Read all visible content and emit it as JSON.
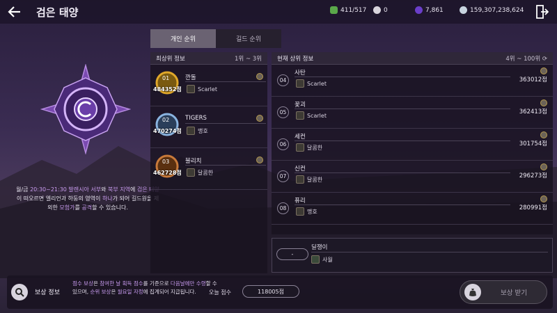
{
  "header": {
    "title": "검은 태양"
  },
  "resources": [
    {
      "icon": "energy-icon",
      "value": "411/517",
      "color": "#5aa84a"
    },
    {
      "icon": "pearl-icon",
      "value": "0",
      "color": "#d8d4dc"
    },
    {
      "icon": "crystal-icon",
      "value": "7,861",
      "color": "#6a3ec9"
    },
    {
      "icon": "silver-icon",
      "value": "159,307,238,624",
      "color": "#c8d4e0"
    }
  ],
  "description": {
    "p1": "월/금 ",
    "p2": "20:30~21:30 ",
    "p3": "발렌시아 서부",
    "p4": "와 ",
    "p5": "북부 지역",
    "p6": "에 ",
    "p7": "검은 태양",
    "p8": "이 떠오르면 엘리언과 하둠의 영역이 ",
    "p9": "하나",
    "p10": "가 되어 길드원을 제외한 ",
    "p11": "모험가",
    "p12": "를 ",
    "p13": "공격",
    "p14": "할 수 있습니다."
  },
  "tabs": [
    {
      "label": "개인 순위"
    },
    {
      "label": "길드 순위"
    }
  ],
  "top_panel": {
    "title": "최상위 정보",
    "range": "1위 ~ 3위"
  },
  "top_ranks": [
    {
      "rank": "01",
      "name": "깐돌",
      "score": "484352점",
      "guild": "Scarlet",
      "color": "#e0a82a"
    },
    {
      "rank": "02",
      "name": "TIGERS",
      "score": "470274점",
      "guild": "맹호",
      "color": "#8ab4e0"
    },
    {
      "rank": "03",
      "name": "불리치",
      "score": "462728점",
      "guild": "달콤한",
      "color": "#c87a3a"
    }
  ],
  "current_panel": {
    "title": "현재 상위 정보",
    "range": "4위 ~ 100위"
  },
  "ranks": [
    {
      "rank": "04",
      "name": "사탄",
      "guild": "Scarlet",
      "score": "363012점"
    },
    {
      "rank": "05",
      "name": "꽃괴",
      "guild": "Scarlet",
      "score": "362413점"
    },
    {
      "rank": "06",
      "name": "세컨",
      "guild": "달콤한",
      "score": "301754점"
    },
    {
      "rank": "07",
      "name": "신컨",
      "guild": "달콤한",
      "score": "296273점"
    },
    {
      "rank": "08",
      "name": "퓨리",
      "guild": "맹호",
      "score": "280991점"
    }
  ],
  "self": {
    "rank": "-",
    "name": "딜쟁이",
    "guild": "사월"
  },
  "reward": {
    "label": "보상 정보",
    "d1": "점수 보상",
    "d2": "은 ",
    "d3": "참여한 날 획득 점수",
    "d4": "를 기준으로 ",
    "d5": "다음날에만 수령",
    "d6": "할 수 있으며, ",
    "d7": "순위 보상",
    "d8": "은 ",
    "d9": "월요일 자정",
    "d10": "에 집계되어 지급됩니다.",
    "today_label": "오늘 점수",
    "today_value": "118005점",
    "claim_label": "보상 받기"
  }
}
